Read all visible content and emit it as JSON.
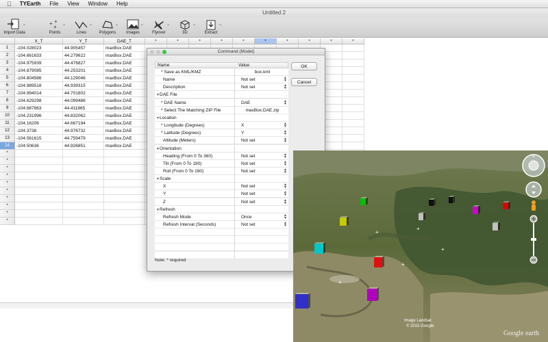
{
  "menubar": {
    "app_name": "TYEarth",
    "items": [
      "File",
      "View",
      "Window",
      "Help"
    ]
  },
  "window": {
    "title": "Untitled 2"
  },
  "toolbar": {
    "buttons": [
      {
        "label": "Import Data"
      },
      {
        "label": "Points"
      },
      {
        "label": "Lines"
      },
      {
        "label": "Polygons"
      },
      {
        "label": "Images"
      },
      {
        "label": "Flyover"
      },
      {
        "label": "3D"
      },
      {
        "label": "Extract"
      }
    ]
  },
  "sheet": {
    "columns": [
      "X_T",
      "Y_T",
      "DAE_T",
      "*",
      "*",
      "*",
      "*",
      "*",
      "*",
      "*",
      "*",
      "*",
      "*"
    ],
    "rows": [
      {
        "num": "1",
        "x": "-104.028023",
        "y": "44.905457",
        "dae": "maxBox.DAE"
      },
      {
        "num": "2",
        "x": "-104.661633",
        "y": "44.279622",
        "dae": "maxBox.DAE"
      },
      {
        "num": "3",
        "x": "-104.975939",
        "y": "44.476827",
        "dae": "maxBox.DAE"
      },
      {
        "num": "4",
        "x": "-104.879085",
        "y": "44.253201",
        "dae": "maxBox.DAE"
      },
      {
        "num": "5",
        "x": "-104.804586",
        "y": "44.129046",
        "dae": "maxBox.DAE"
      },
      {
        "num": "6",
        "x": "-104.989518",
        "y": "44.939315",
        "dae": "maxBox.DAE"
      },
      {
        "num": "7",
        "x": "-104.994014",
        "y": "44.701802",
        "dae": "maxBox.DAE"
      },
      {
        "num": "8",
        "x": "-104.629298",
        "y": "44.099486",
        "dae": "maxBox.DAE"
      },
      {
        "num": "9",
        "x": "-104.687863",
        "y": "44.411865",
        "dae": "maxBox.DAE"
      },
      {
        "num": "10",
        "x": "-104.231996",
        "y": "44.832062",
        "dae": "maxBox.DAE"
      },
      {
        "num": "11",
        "x": "-104.16206",
        "y": "44.667194",
        "dae": "maxBox.DAE"
      },
      {
        "num": "12",
        "x": "-104.3738",
        "y": "44.976732",
        "dae": "maxBox.DAE"
      },
      {
        "num": "13",
        "x": "-104.561615",
        "y": "44.759479",
        "dae": "maxBox.DAE"
      },
      {
        "num": "14",
        "x": "-104.50636",
        "y": "44.926851",
        "dae": "maxBox.DAE"
      }
    ],
    "empty_row_marker": "*"
  },
  "dialog": {
    "title": "Command (Model)",
    "col_name": "Name",
    "col_value": "Value",
    "ok_label": "OK",
    "cancel_label": "Cancel",
    "note": "Note:  *  required",
    "rows": [
      {
        "name": "* Save as KML/KMZ",
        "value": "box.kml",
        "kind": "text"
      },
      {
        "name": "Name",
        "value": "Not set",
        "kind": "select"
      },
      {
        "name": "Description",
        "value": "Not set",
        "kind": "select"
      },
      {
        "name": "DAE File",
        "value": "",
        "kind": "section"
      },
      {
        "name": "* DAE Name",
        "value": "DAE",
        "kind": "select"
      },
      {
        "name": "* Select The Matching ZIP File",
        "value": "maxBox.DAE.zip",
        "kind": "text"
      },
      {
        "name": "Location",
        "value": "",
        "kind": "section"
      },
      {
        "name": "* Longitude (Degrees)",
        "value": "X",
        "kind": "select"
      },
      {
        "name": "* Latitude (Degrees)",
        "value": "Y",
        "kind": "select"
      },
      {
        "name": "Altitude (Meters)",
        "value": "Not set",
        "kind": "select"
      },
      {
        "name": "Orientation",
        "value": "",
        "kind": "section"
      },
      {
        "name": "Heading (From 0 To 360)",
        "value": "Not set",
        "kind": "select"
      },
      {
        "name": "Tilt (From 0 To 180)",
        "value": "Not set",
        "kind": "select"
      },
      {
        "name": "Roll (From 0 To 180)",
        "value": "Not set",
        "kind": "select"
      },
      {
        "name": "Scale",
        "value": "",
        "kind": "section"
      },
      {
        "name": "X",
        "value": "Not set",
        "kind": "select"
      },
      {
        "name": "Y",
        "value": "Not set",
        "kind": "select"
      },
      {
        "name": "Z",
        "value": "Not set",
        "kind": "select"
      },
      {
        "name": "Refresh",
        "value": "",
        "kind": "section"
      },
      {
        "name": "Refresh Mode",
        "value": "Once",
        "kind": "select"
      },
      {
        "name": "Refresh Interval (Seconds)",
        "value": "Not set",
        "kind": "select"
      }
    ]
  },
  "map": {
    "attribution": "Image Landsat",
    "copyright": "© 2015 Google",
    "logo": "Google earth",
    "box_colors": [
      "#00c000",
      "#c8c800",
      "#00c8c8",
      "#e01010",
      "#b000c0",
      "#3030c8",
      "#101010",
      "#c0c0c0",
      "#d000d0",
      "#e00000"
    ]
  }
}
